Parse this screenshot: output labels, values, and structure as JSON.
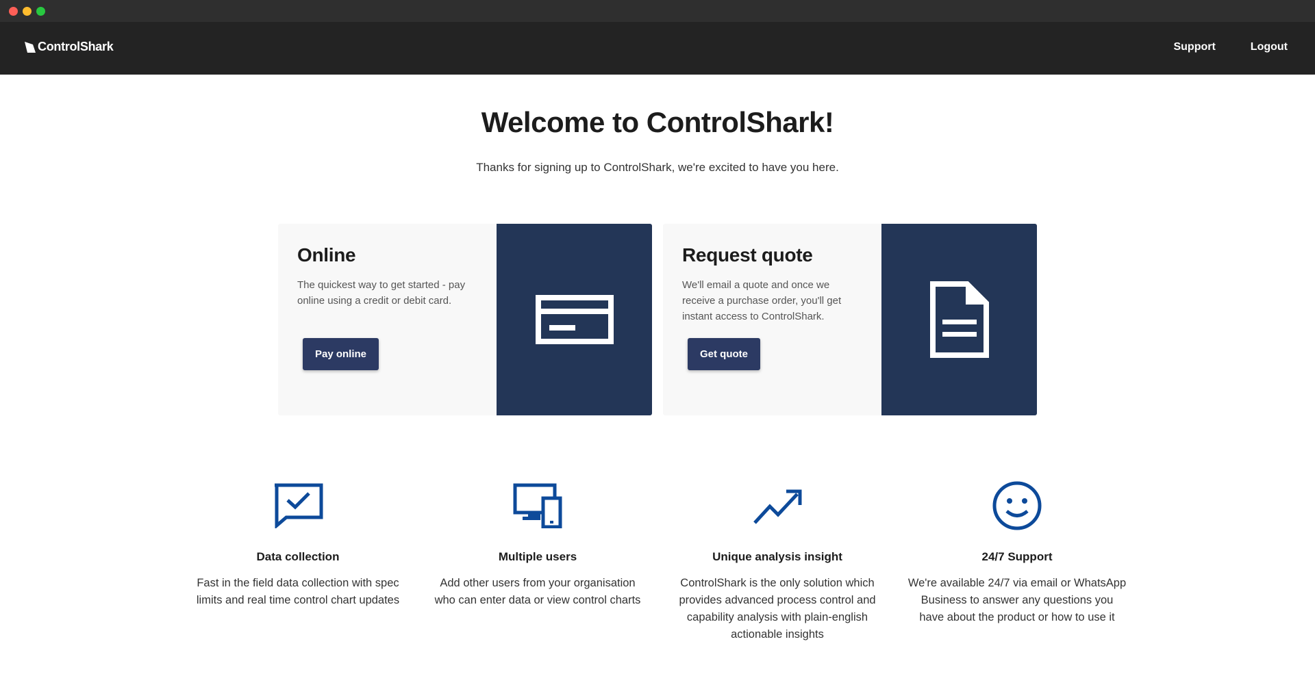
{
  "nav": {
    "brand": "ControlShark",
    "links": [
      "Support",
      "Logout"
    ]
  },
  "welcome": {
    "title": "Welcome to ControlShark!",
    "subtitle": "Thanks for signing up to ControlShark, we're excited to have you here."
  },
  "cards": [
    {
      "title": "Online",
      "description": "The quickest way to get started - pay online using a credit or debit card.",
      "button": "Pay online",
      "icon": "credit-card-icon"
    },
    {
      "title": "Request quote",
      "description": "We'll email a quote and once we receive a purchase order, you'll get instant access to ControlShark.",
      "button": "Get quote",
      "icon": "document-icon"
    }
  ],
  "features": [
    {
      "title": "Data collection",
      "description": "Fast in the field data collection with spec limits and real time control chart updates",
      "icon": "chat-check-icon"
    },
    {
      "title": "Multiple users",
      "description": "Add other users from your organisation who can enter data or view control charts",
      "icon": "devices-icon"
    },
    {
      "title": "Unique analysis insight",
      "description": "ControlShark is the only solution which provides advanced process control and capability analysis with plain-english actionable insights",
      "icon": "trend-up-icon"
    },
    {
      "title": "24/7 Support",
      "description": "We're available 24/7 via email or WhatsApp Business to answer any questions you have about the product or how to use it",
      "icon": "smiley-icon"
    }
  ],
  "colors": {
    "navbar": "#232323",
    "button": "#2c3a63",
    "panel": "#233657",
    "feature_icon": "#0d4a9a"
  }
}
